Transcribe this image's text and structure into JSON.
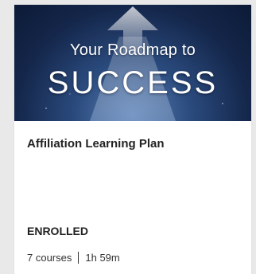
{
  "card": {
    "banner_line1": "Your Roadmap to",
    "banner_line2": "SUCCESS",
    "title": "Affiliation Learning Plan",
    "status": "ENROLLED",
    "courses": "7 courses",
    "duration": "1h 59m"
  }
}
